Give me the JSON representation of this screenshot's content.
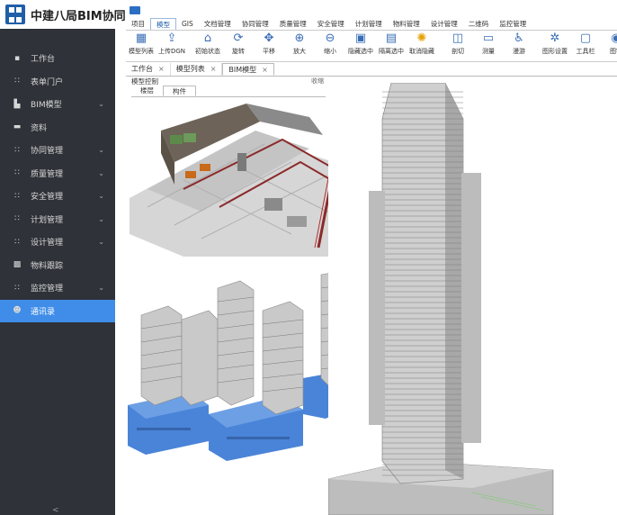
{
  "brand": {
    "title": "中建八局BIM协同"
  },
  "menu": {
    "tabs": [
      {
        "label": "项目",
        "active": false
      },
      {
        "label": "模型",
        "active": true
      },
      {
        "label": "GIS",
        "active": false
      },
      {
        "label": "文档管理",
        "active": false
      },
      {
        "label": "协同管理",
        "active": false
      },
      {
        "label": "质量管理",
        "active": false
      },
      {
        "label": "安全管理",
        "active": false
      },
      {
        "label": "计划管理",
        "active": false
      },
      {
        "label": "物料管理",
        "active": false
      },
      {
        "label": "设计管理",
        "active": false
      },
      {
        "label": "二维码",
        "active": false
      },
      {
        "label": "监控管理",
        "active": false
      }
    ]
  },
  "ribbon": {
    "tools": [
      {
        "label": "模型列表",
        "icon": "grid-icon"
      },
      {
        "label": "上传DGN",
        "icon": "upload-icon"
      },
      {
        "label": "初始状态",
        "icon": "home-icon"
      },
      {
        "label": "旋转",
        "icon": "rotate-icon"
      },
      {
        "label": "平移",
        "icon": "move-icon"
      },
      {
        "label": "放大",
        "icon": "zoom-in-icon"
      },
      {
        "label": "缩小",
        "icon": "zoom-out-icon"
      },
      {
        "label": "隐藏选中",
        "icon": "hide-selected-icon"
      },
      {
        "label": "隔离选中",
        "icon": "isolate-icon"
      },
      {
        "label": "取消隐藏",
        "icon": "bulb-icon"
      },
      {
        "label": "剖切",
        "icon": "section-icon"
      },
      {
        "label": "测量",
        "icon": "measure-icon"
      },
      {
        "label": "漫游",
        "icon": "walk-icon"
      },
      {
        "label": "图形设置",
        "icon": "graphics-icon"
      },
      {
        "label": "工具栏",
        "icon": "toolbar-icon"
      },
      {
        "label": "图钉",
        "icon": "pin-icon"
      }
    ]
  },
  "sidebar": {
    "items": [
      {
        "label": "工作台",
        "icon": "dashboard-icon",
        "chevron": false,
        "active": false
      },
      {
        "label": "表单门户",
        "icon": "apps-icon",
        "chevron": false,
        "active": false
      },
      {
        "label": "BIM模型",
        "icon": "building-icon",
        "chevron": true,
        "active": false
      },
      {
        "label": "资料",
        "icon": "folder-icon",
        "chevron": false,
        "active": false
      },
      {
        "label": "协同管理",
        "icon": "apps-icon",
        "chevron": true,
        "active": false
      },
      {
        "label": "质量管理",
        "icon": "apps-icon",
        "chevron": true,
        "active": false
      },
      {
        "label": "安全管理",
        "icon": "apps-icon",
        "chevron": true,
        "active": false
      },
      {
        "label": "计划管理",
        "icon": "apps-icon",
        "chevron": true,
        "active": false
      },
      {
        "label": "设计管理",
        "icon": "apps-icon",
        "chevron": true,
        "active": false
      },
      {
        "label": "物料跟踪",
        "icon": "cube-icon",
        "chevron": false,
        "active": false
      },
      {
        "label": "监控管理",
        "icon": "apps-icon",
        "chevron": true,
        "active": false
      },
      {
        "label": "通讯录",
        "icon": "contacts-icon",
        "chevron": false,
        "active": true
      }
    ]
  },
  "doc_tabs": [
    {
      "label": "工作台",
      "active": false
    },
    {
      "label": "模型列表",
      "active": false
    },
    {
      "label": "BIM模型",
      "active": true
    }
  ],
  "panel": {
    "title": "模型控制",
    "close_label": "收缩",
    "tabs": [
      {
        "label": "楼层",
        "active": false
      },
      {
        "label": "构件",
        "active": true
      }
    ]
  },
  "colors": {
    "sidebar_bg": "#2f3238",
    "sidebar_active": "#3f8de8",
    "accent": "#1f5fa8",
    "podium_blue": "#4a84d8"
  }
}
